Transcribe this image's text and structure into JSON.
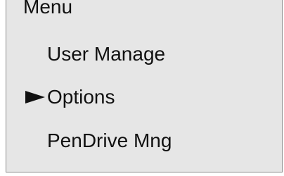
{
  "menu": {
    "title": "Menu",
    "selected_index": 1,
    "items": [
      {
        "label": "User Manage"
      },
      {
        "label": "Options"
      },
      {
        "label": "PenDrive Mng"
      }
    ]
  },
  "colors": {
    "panel_background": "#e6e6e6",
    "panel_border": "#8c8c8c",
    "text": "#111111"
  },
  "icons": {
    "selection_marker": "right-pointing-triangle-icon"
  }
}
